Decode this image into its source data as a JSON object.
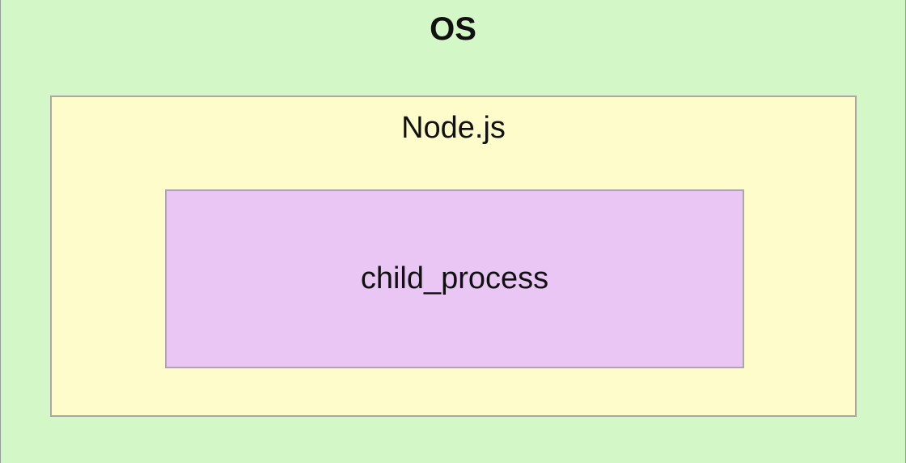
{
  "diagram": {
    "outer": {
      "label": "OS",
      "color": "#d4f7c8"
    },
    "middle": {
      "label": "Node.js",
      "color": "#fefccb"
    },
    "inner": {
      "label": "child_process",
      "color": "#e9c6f4"
    }
  }
}
